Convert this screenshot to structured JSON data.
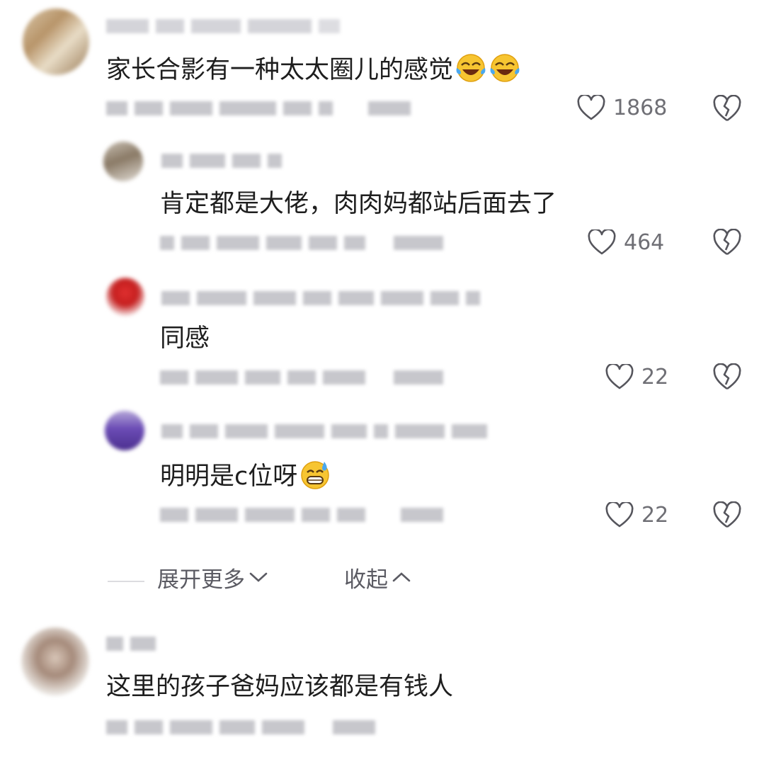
{
  "comments": [
    {
      "text": "家长合影有一种太太圈儿的感觉",
      "likes": "1868"
    },
    {
      "text": "肯定都是大佬，肉肉妈都站后面去了",
      "likes": "464"
    },
    {
      "text": "同感",
      "likes": "22"
    },
    {
      "text": "明明是c位呀",
      "likes": "22"
    },
    {
      "text": "这里的孩子爸妈应该都是有钱人"
    }
  ],
  "thread": {
    "expand_label": "展开更多",
    "collapse_label": "收起"
  },
  "icons": {
    "like": "heart-outline-icon",
    "dislike": "broken-heart-icon",
    "laugh": "laughing-tears-emoji",
    "sweat": "grin-sweat-emoji"
  }
}
